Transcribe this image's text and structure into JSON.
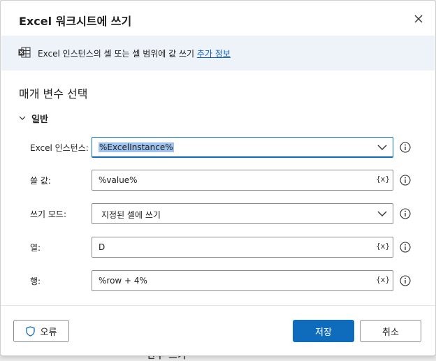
{
  "dialog": {
    "title": "Excel 워크시트에 쓰기",
    "close_icon": "close-icon"
  },
  "banner": {
    "icon": "excel-worksheet-icon",
    "text": "Excel 인스턴스의 셀 또는 셀 범위에 값 쓰기",
    "link": "추가 정보"
  },
  "section": {
    "title": "매개 변수 선택",
    "group": "일반"
  },
  "fields": {
    "instance": {
      "label": "Excel 인스턴스:",
      "value": "%ExcelInstance%"
    },
    "value": {
      "label": "쓸 값:",
      "value": "%value%",
      "var_button": "{x}"
    },
    "mode": {
      "label": "쓰기 모드:",
      "value": "지정된 셀에 쓰기"
    },
    "column": {
      "label": "열:",
      "value": "D",
      "var_button": "{x}"
    },
    "row": {
      "label": "행:",
      "value": "%row + 4%",
      "var_button": "{x}"
    }
  },
  "footer": {
    "error_label": "오류",
    "save_label": "저장",
    "cancel_label": "취소"
  },
  "background": {
    "peek_text": "변수 쓰기"
  },
  "colors": {
    "accent": "#0f6cbd",
    "banner_bg": "#eef3fa",
    "selection": "#9ec3ef"
  }
}
